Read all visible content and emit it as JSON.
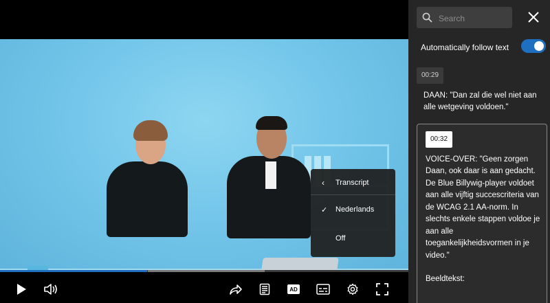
{
  "player": {
    "menu": {
      "back_label": "Transcript",
      "options": [
        {
          "label": "Nederlands",
          "selected": true
        },
        {
          "label": "Off",
          "selected": false
        }
      ]
    },
    "progress": 0.36,
    "controls": {
      "ad_label": "AD"
    }
  },
  "transcript": {
    "search_placeholder": "Search",
    "follow_label": "Automatically follow text",
    "follow_enabled": true,
    "entries": [
      {
        "time": "00:29",
        "text": "DAAN: \"Dan zal die wel niet aan alle wetgeving voldoen.\""
      },
      {
        "time": "00:32",
        "text": "VOICE-OVER: \"Geen zorgen Daan, ook daar is aan gedacht. De Blue Billywig-player voldoet aan alle vijftig succescriteria van de WCAG 2.1 AA-norm. In slechts enkele stappen voldoe je aan alle toegankelijkheidsvormen in je video.\"",
        "caption_label": "Beeldtekst:"
      }
    ]
  },
  "colors": {
    "accent": "#1f6fc0",
    "panel_bg": "#262626"
  }
}
